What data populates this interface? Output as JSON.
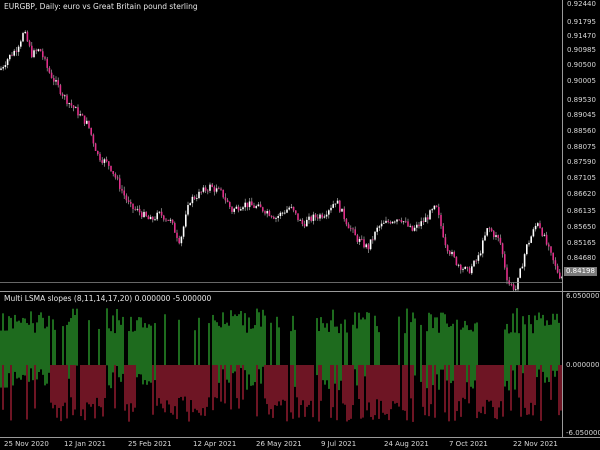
{
  "main_chart": {
    "title": "EURGBP, Daily:  euro vs Great Britain pound sterling",
    "price_ticks": [
      "0.92440",
      "0.91795",
      "0.91470",
      "0.90985",
      "0.90500",
      "0.90005",
      "0.89530",
      "0.89045",
      "0.88560",
      "0.88075",
      "0.87590",
      "0.87105",
      "0.86620",
      "0.86135",
      "0.85650",
      "0.85165",
      "0.84680",
      "0.84195"
    ],
    "current_price_label": "0.84198",
    "colors": {
      "candle_up": "#ffffff",
      "candle_down": "#e0308a",
      "wick": "#c0c0c0"
    }
  },
  "indicator": {
    "title": "Multi LSMA slopes (8,11,14,17,20) 0.000000 -5.000000",
    "ticks": [
      "6.050000",
      "0.000000",
      "-6.050000"
    ],
    "colors": {
      "positive": "#1e6b1e",
      "negative": "#6e1524"
    }
  },
  "time_axis": {
    "labels": [
      "25 Nov 2020",
      "12 Jan 2021",
      "25 Feb 2021",
      "12 Apr 2021",
      "26 May 2021",
      "9 Jul 2021",
      "24 Aug 2021",
      "7 Oct 2021",
      "22 Nov 2021"
    ]
  },
  "chart_data": [
    {
      "type": "line",
      "title": "EURGBP, Daily:  euro vs Great Britain pound sterling",
      "xlabel": "",
      "ylabel": "",
      "x": [
        "25 Nov 2020",
        "12 Jan 2021",
        "25 Feb 2021",
        "12 Apr 2021",
        "26 May 2021",
        "9 Jul 2021",
        "24 Aug 2021",
        "7 Oct 2021",
        "22 Nov 2021"
      ],
      "series": [
        {
          "values": [
            0.9045,
            0.9015,
            0.8745,
            0.8605,
            0.858,
            0.857,
            0.854,
            0.853,
            0.8535
          ]
        }
      ],
      "ylim": [
        0.8395,
        0.9244
      ],
      "grid": false
    },
    {
      "type": "bar",
      "title": "Multi LSMA slopes (8,11,14,17,20) 0.000000 -5.000000",
      "xlabel": "",
      "ylabel": "",
      "series": [
        {
          "values": [
            5.0,
            -5.0,
            0.0,
            -5.0,
            -5.0,
            0.0,
            5.0,
            0.0,
            -5.0
          ]
        }
      ],
      "categories": [
        "25 Nov 2020",
        "12 Jan 2021",
        "25 Feb 2021",
        "12 Apr 2021",
        "26 May 2021",
        "9 Jul 2021",
        "24 Aug 2021",
        "7 Oct 2021",
        "22 Nov 2021"
      ],
      "ylim": [
        -6.05,
        6.05
      ],
      "grid": false
    }
  ]
}
